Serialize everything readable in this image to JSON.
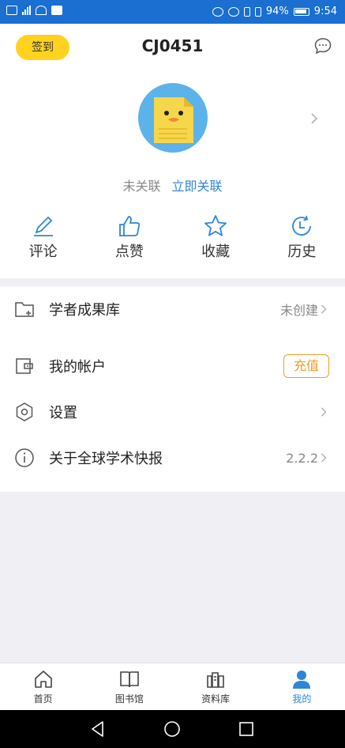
{
  "status_bar": {
    "battery": "94%",
    "time": "9:54"
  },
  "header": {
    "checkin_label": "签到",
    "title": "CJ0451",
    "message_icon": "chat-bubble-icon"
  },
  "profile": {
    "status_text": "未关联",
    "link_label": "立即关联"
  },
  "actions": [
    {
      "label": "评论",
      "icon": "pencil-icon"
    },
    {
      "label": "点赞",
      "icon": "thumbs-up-icon"
    },
    {
      "label": "收藏",
      "icon": "star-icon"
    },
    {
      "label": "历史",
      "icon": "clock-icon"
    }
  ],
  "menu": [
    {
      "title": "学者成果库",
      "value": "未创建",
      "icon": "folder-add-icon"
    },
    {
      "title": "我的帐户",
      "button": "充值",
      "icon": "wallet-icon"
    },
    {
      "title": "设置",
      "icon": "settings-icon"
    },
    {
      "title": "关于全球学术快报",
      "value": "2.2.2",
      "icon": "info-icon"
    }
  ],
  "tabs": [
    {
      "label": "首页",
      "icon": "home-icon"
    },
    {
      "label": "图书馆",
      "icon": "book-icon"
    },
    {
      "label": "资料库",
      "icon": "archive-icon"
    },
    {
      "label": "我的",
      "icon": "user-icon",
      "active": true
    }
  ],
  "colors": {
    "accent": "#2f86d6",
    "checkin_bg": "#ffd21f",
    "recharge": "#f29a2e",
    "status_bar": "#1a6fd0"
  }
}
